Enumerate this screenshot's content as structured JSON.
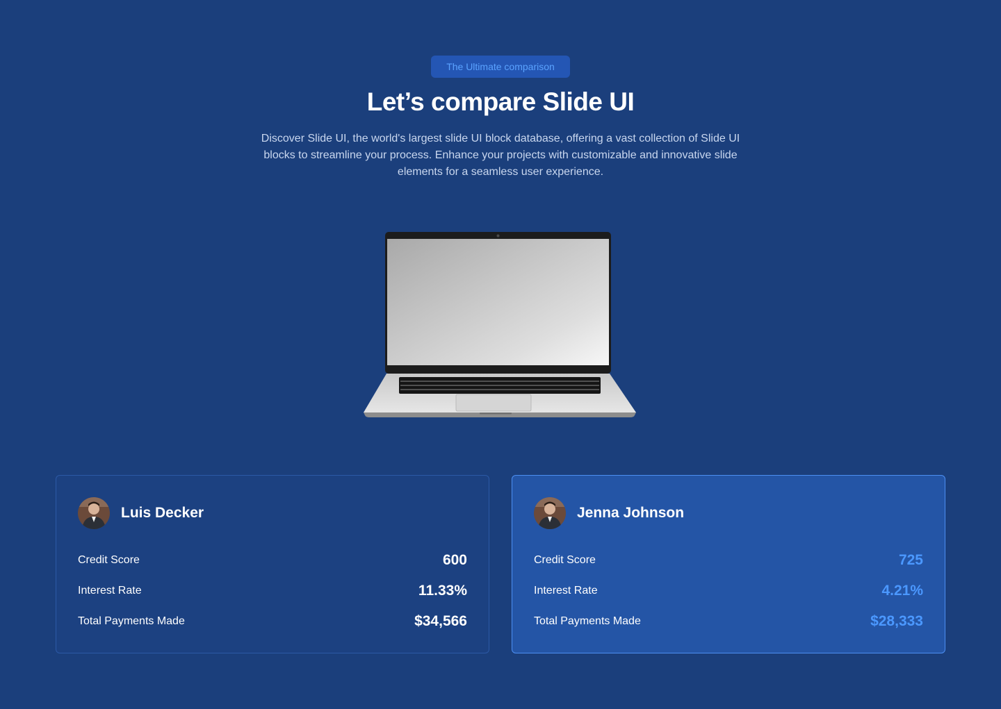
{
  "header": {
    "badge": "The Ultimate comparison",
    "title": "Let’s compare Slide UI",
    "description": "Discover Slide UI, the world's largest slide UI block database, offering a vast collection of Slide UI blocks to streamline your process. Enhance your projects with customizable and innovative slide elements for a seamless user experience."
  },
  "colors": {
    "background": "#1b3f7c",
    "badge_bg": "#2456b4",
    "badge_text": "#5aa2ff",
    "highlight_value": "#4b98ff"
  },
  "cards": [
    {
      "name": "Luis Decker",
      "rows": [
        {
          "label": "Credit Score",
          "value": "600"
        },
        {
          "label": "Interest Rate",
          "value": "11.33%"
        },
        {
          "label": "Total Payments Made",
          "value": "$34,566"
        }
      ]
    },
    {
      "name": "Jenna Johnson",
      "rows": [
        {
          "label": "Credit Score",
          "value": "725"
        },
        {
          "label": "Interest Rate",
          "value": "4.21%"
        },
        {
          "label": "Total Payments Made",
          "value": "$28,333"
        }
      ]
    }
  ]
}
